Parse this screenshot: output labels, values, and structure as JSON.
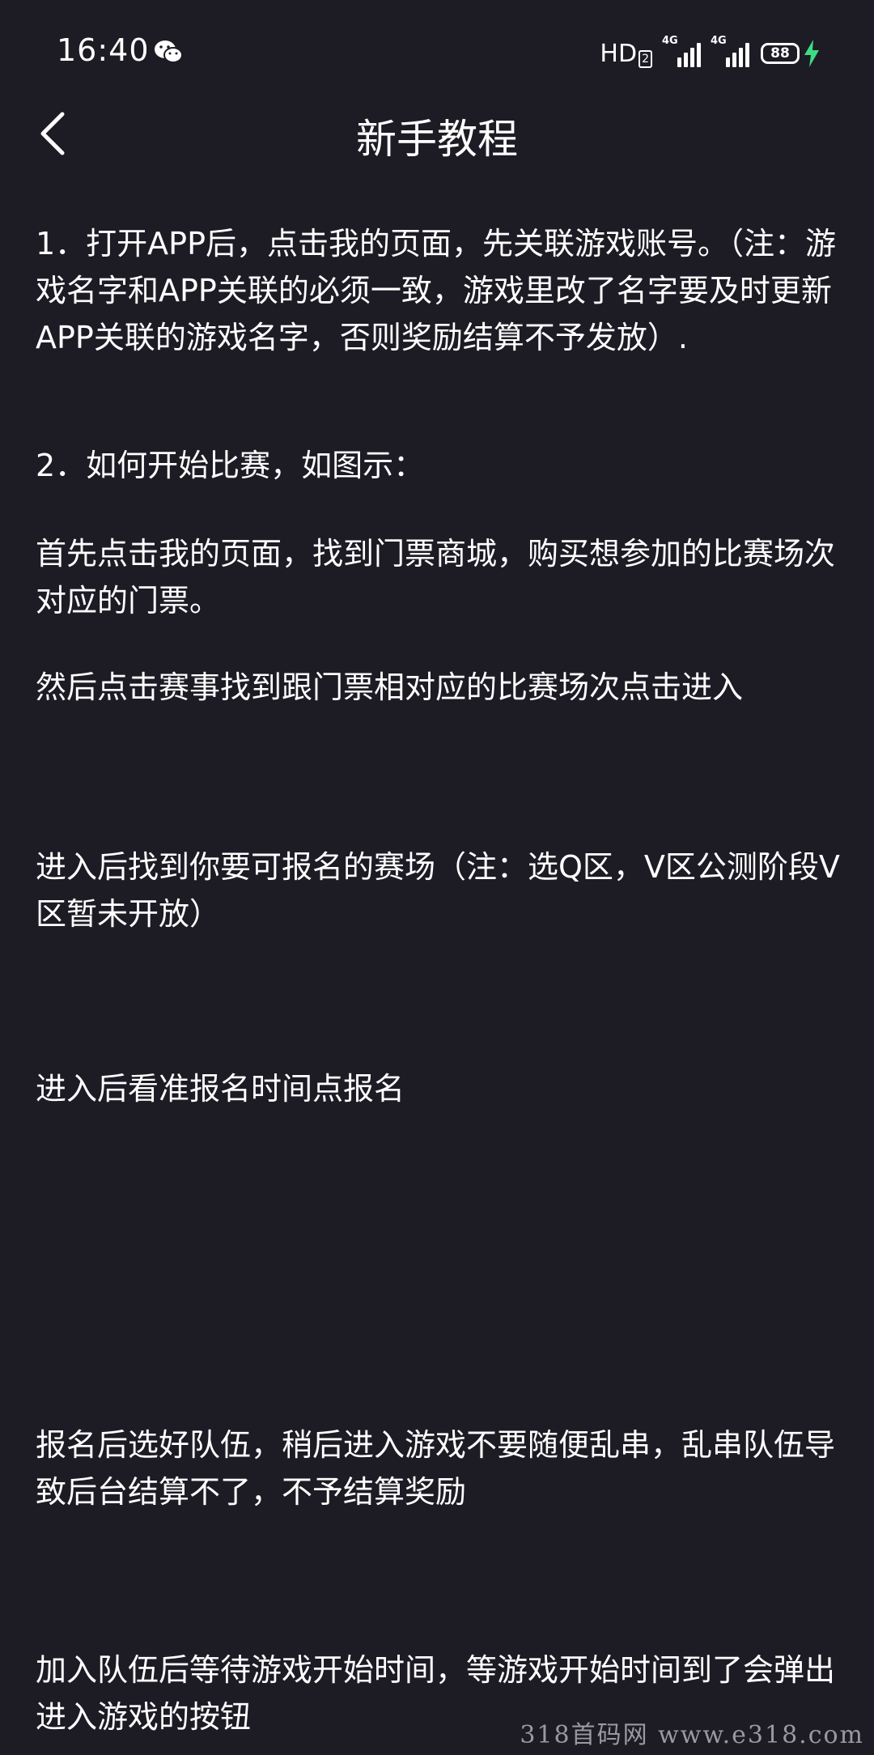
{
  "status_bar": {
    "time": "16:40",
    "hd_label": "HD",
    "hd_sub": "2",
    "network_1": "4G",
    "network_2": "4G",
    "battery": "88"
  },
  "header": {
    "title": "新手教程"
  },
  "content": {
    "paragraphs": [
      "1．打开APP后，点击我的页面，先关联游戏账号。（注：游戏名字和APP关联的必须一致，游戏里改了名字要及时更新APP关联的游戏名字，否则奖励结算不予发放）.",
      "2．如何开始比赛，如图示：",
      "首先点击我的页面，找到门票商城，购买想参加的比赛场次对应的门票。",
      "然后点击赛事找到跟门票相对应的比赛场次点击进入",
      "进入后找到你要可报名的赛场（注：选Q区，V区公测阶段V区暂未开放）",
      "进入后看准报名时间点报名",
      "报名后选好队伍，稍后进入游戏不要随便乱串，乱串队伍导致后台结算不了，不予结算奖励",
      "加入队伍后等待游戏开始时间，等游戏开始时间到了会弹出进入游戏的按钮"
    ]
  },
  "watermark": "318首码网  www.e318.com"
}
